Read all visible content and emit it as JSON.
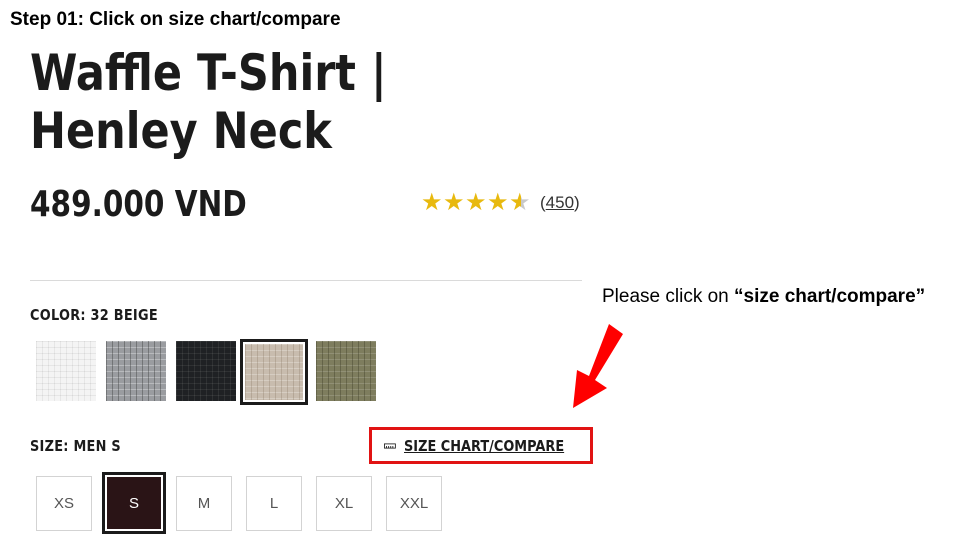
{
  "step_title": "Step 01: Click on size chart/compare",
  "product": {
    "title": "Waffle T-Shirt | Henley Neck",
    "price": "489.000 VND",
    "rating_stars": 4.5,
    "review_count_open": "(",
    "review_count": "450",
    "review_count_close": ")"
  },
  "color": {
    "label": "COLOR: 32 BEIGE",
    "swatches": [
      {
        "name": "white",
        "hex": "#f4f4f4",
        "selected": false
      },
      {
        "name": "gray",
        "hex": "#9a9ca0",
        "selected": false
      },
      {
        "name": "black",
        "hex": "#1f2124",
        "selected": false
      },
      {
        "name": "beige",
        "hex": "#c8bcae",
        "selected": true
      },
      {
        "name": "olive",
        "hex": "#7e7d5e",
        "selected": false
      }
    ]
  },
  "size": {
    "label": "SIZE: MEN S",
    "chart_link": "SIZE CHART/COMPARE",
    "options": [
      "XS",
      "S",
      "M",
      "L",
      "XL",
      "XXL"
    ],
    "selected": "S"
  },
  "helper": {
    "prefix": "Please click on ",
    "emphasis": "“size chart/compare”"
  },
  "colors": {
    "highlight_box": "#e11313",
    "arrow": "#ff0000",
    "star": "#e8b90e",
    "selected_size_bg": "#2a1416"
  }
}
